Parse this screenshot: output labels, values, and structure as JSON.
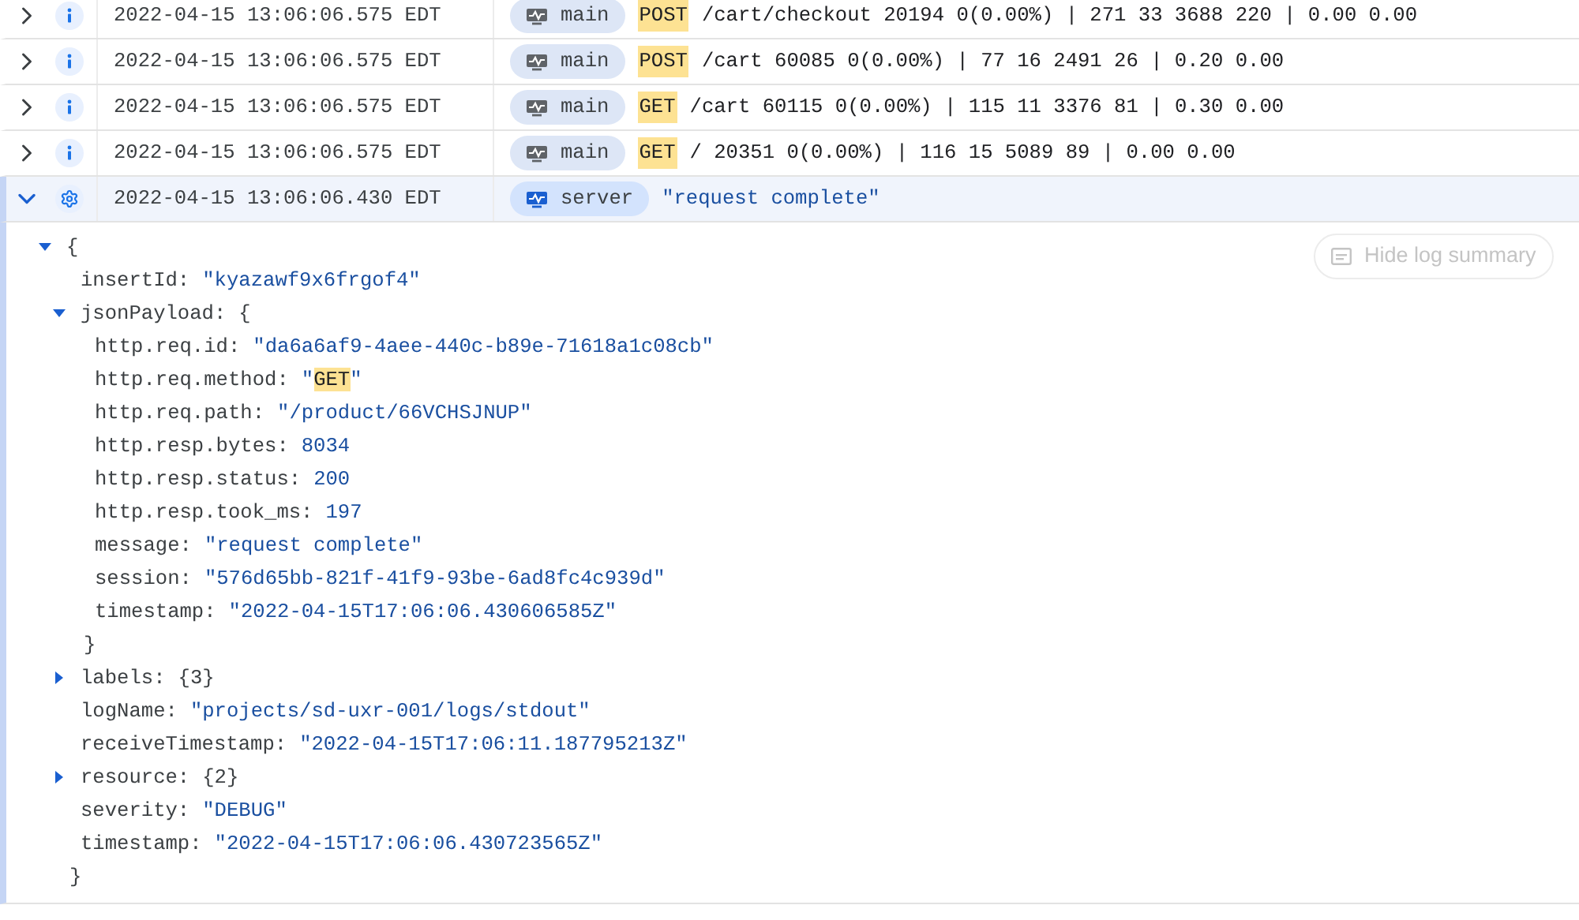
{
  "rows": [
    {
      "expanded": false,
      "kind": "info",
      "timestamp": "2022-04-15 13:06:06.575 EDT",
      "resource": "main",
      "method": "POST",
      "summary": {
        "kind": "plain",
        "text": "/cart/checkout 20194 0(0.00%) | 271 33 3688 220 | 0.00 0.00"
      }
    },
    {
      "expanded": false,
      "kind": "info",
      "timestamp": "2022-04-15 13:06:06.575 EDT",
      "resource": "main",
      "method": "POST",
      "summary": {
        "kind": "plain",
        "text": "/cart 60085 0(0.00%) | 77 16 2491 26 | 0.20 0.00"
      }
    },
    {
      "expanded": false,
      "kind": "info",
      "timestamp": "2022-04-15 13:06:06.575 EDT",
      "resource": "main",
      "method": "GET",
      "summary": {
        "kind": "plain",
        "text": "/cart 60115 0(0.00%) | 115 11 3376 81 | 0.30 0.00"
      }
    },
    {
      "expanded": false,
      "kind": "info",
      "timestamp": "2022-04-15 13:06:06.575 EDT",
      "resource": "main",
      "method": "GET",
      "summary": {
        "kind": "plain",
        "text": "/ 20351 0(0.00%) | 116 15 5089 89 | 0.00 0.00"
      }
    },
    {
      "expanded": true,
      "kind": "debug",
      "timestamp": "2022-04-15 13:06:06.430 EDT",
      "resource": "server",
      "summary": {
        "kind": "string",
        "text": "\"request complete\""
      }
    }
  ],
  "detail": {
    "hide_summary_button": "Hide log summary",
    "tree": {
      "open": "{",
      "close": "}",
      "expanded": true,
      "children": [
        {
          "key": "insertId:",
          "value": "\"kyazawf9x6frgof4\""
        },
        {
          "key": "jsonPayload:",
          "open": "{",
          "close": "}",
          "expanded": true,
          "children": [
            {
              "key": "http.req.id:",
              "value": "\"da6a6af9-4aee-440c-b89e-71618a1c08cb\""
            },
            {
              "key": "http.req.method:",
              "prefix": "\"",
              "value": "GET",
              "suffix": "\"",
              "highlighted": true
            },
            {
              "key": "http.req.path:",
              "value": "\"/product/66VCHSJNUP\""
            },
            {
              "key": "http.resp.bytes:",
              "value": "8034"
            },
            {
              "key": "http.resp.status:",
              "value": "200"
            },
            {
              "key": "http.resp.took_ms:",
              "value": "197"
            },
            {
              "key": "message:",
              "value": "\"request complete\""
            },
            {
              "key": "session:",
              "value": "\"576d65bb-821f-41f9-93be-6ad8fc4c939d\""
            },
            {
              "key": "timestamp:",
              "value": "\"2022-04-15T17:06:06.430606585Z\""
            }
          ]
        },
        {
          "key": "labels:",
          "expanded": false,
          "summary": "{3}"
        },
        {
          "key": "logName:",
          "value": "\"projects/sd-uxr-001/logs/stdout\""
        },
        {
          "key": "receiveTimestamp:",
          "value": "\"2022-04-15T17:06:11.187795213Z\""
        },
        {
          "key": "resource:",
          "expanded": false,
          "summary": "{2}"
        },
        {
          "key": "severity:",
          "value": "\"DEBUG\""
        },
        {
          "key": "timestamp:",
          "value": "\"2022-04-15T17:06:06.430723565Z\""
        }
      ]
    }
  }
}
